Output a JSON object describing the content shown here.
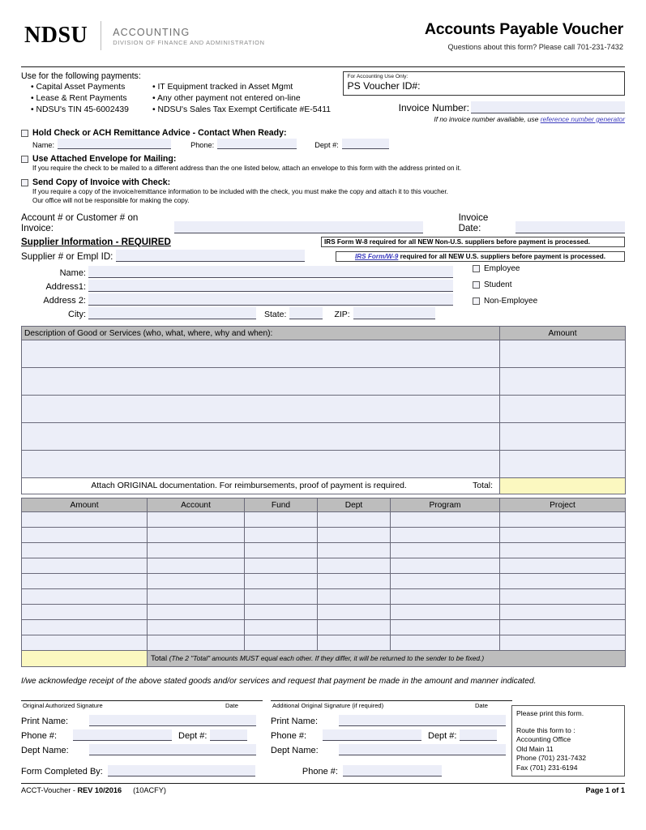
{
  "header": {
    "logo": "NDSU",
    "dept_main": "ACCOUNTING",
    "dept_sub": "DIVISION OF FINANCE AND ADMINISTRATION",
    "title": "Accounts Payable Voucher",
    "subtitle": "Questions about this form? Please call 701-231-7432"
  },
  "uses": {
    "title": "Use for the following payments:",
    "items_left": [
      "Capital Asset Payments",
      "Lease & Rent Payments",
      "NDSU's TIN 45-6002439"
    ],
    "items_right": [
      "IT Equipment tracked in Asset Mgmt",
      "Any other payment not entered on-line",
      "NDSU's Sales Tax Exempt Certificate #E-5411"
    ]
  },
  "accounting_use": {
    "small_label": "For Accounting Use Only:",
    "voucher_label": "PS Voucher ID#:",
    "voucher_value": "",
    "invoice_number_label": "Invoice Number:",
    "invoice_number_value": "",
    "invoice_note_prefix": "If no invoice number available, use ",
    "invoice_note_link": "reference number generator"
  },
  "options": [
    {
      "title": "Hold Check or ACH Remittance Advice - Contact When Ready:",
      "checked": false,
      "fields": [
        {
          "label": "Name:",
          "value": ""
        },
        {
          "label": "Phone:",
          "value": ""
        },
        {
          "label": "Dept #:",
          "value": ""
        }
      ],
      "desc": []
    },
    {
      "title": "Use Attached Envelope for Mailing:",
      "checked": false,
      "fields": [],
      "desc": [
        "If you require the check to be mailed to a different address than the one listed below, attach an envelope to this form with the address printed on it."
      ]
    },
    {
      "title": "Send Copy of Invoice with Check:",
      "checked": false,
      "fields": [],
      "desc": [
        "If you require a copy of the invoice/remittance information to be included with the check, you must make the copy and attach it to this voucher.",
        "Our office will not be responsible for making the copy."
      ]
    }
  ],
  "account_line": {
    "label": "Account # or Customer # on Invoice:",
    "value": "",
    "invoice_date_label": "Invoice Date:",
    "invoice_date_value": ""
  },
  "supplier": {
    "section_title": "Supplier Information - REQUIRED",
    "id_label": "Supplier # or Empl ID:",
    "id_value": "",
    "w8_notice": "IRS Form W-8 required for all NEW Non-U.S. suppliers before payment is processed.",
    "w9_link": "IRS Form/W-9",
    "w9_notice": " required for all NEW U.S. suppliers before payment is processed.",
    "fields": [
      {
        "label": "Name:",
        "value": ""
      },
      {
        "label": "Address1:",
        "value": ""
      },
      {
        "label": "Address 2:",
        "value": ""
      }
    ],
    "city_label": "City:",
    "city_value": "",
    "state_label": "State:",
    "state_value": "",
    "zip_label": "ZIP:",
    "zip_value": "",
    "types": [
      {
        "label": "Employee",
        "checked": false
      },
      {
        "label": "Student",
        "checked": false
      },
      {
        "label": "Non-Employee",
        "checked": false
      }
    ]
  },
  "description_table": {
    "header_description": "Description of Good or Services (who, what, where, why and when):",
    "header_amount": "Amount",
    "rows": [
      {
        "description": "",
        "amount": ""
      },
      {
        "description": "",
        "amount": ""
      },
      {
        "description": "",
        "amount": ""
      },
      {
        "description": "",
        "amount": ""
      },
      {
        "description": "",
        "amount": ""
      }
    ],
    "footer_note": "Attach ORIGINAL documentation. For reimbursements, proof of payment is required.",
    "total_label": "Total:",
    "total_value": ""
  },
  "accounting_table": {
    "headers": [
      "Amount",
      "Account",
      "Fund",
      "Dept",
      "Program",
      "Project"
    ],
    "rows": [
      [
        "",
        "",
        "",
        "",
        "",
        ""
      ],
      [
        "",
        "",
        "",
        "",
        "",
        ""
      ],
      [
        "",
        "",
        "",
        "",
        "",
        ""
      ],
      [
        "",
        "",
        "",
        "",
        "",
        ""
      ],
      [
        "",
        "",
        "",
        "",
        "",
        ""
      ],
      [
        "",
        "",
        "",
        "",
        "",
        ""
      ],
      [
        "",
        "",
        "",
        "",
        "",
        ""
      ],
      [
        "",
        "",
        "",
        "",
        "",
        ""
      ],
      [
        "",
        "",
        "",
        "",
        "",
        ""
      ]
    ],
    "total_value": "",
    "total_label": "Total",
    "total_note": "(The 2 \"Total\" amounts MUST equal each other. If they differ, it will be returned to the sender to be fixed.)"
  },
  "acknowledgement": "I/we acknowledge receipt of the above stated goods and/or services and request that payment be made in the amount and manner indicated.",
  "signatures": {
    "left": {
      "caption": "Original Authorized Signature",
      "date_caption": "Date",
      "print_name_label": "Print Name:",
      "print_name_value": "",
      "phone_label": "Phone #:",
      "phone_value": "",
      "dept_num_label": "Dept #:",
      "dept_num_value": "",
      "dept_name_label": "Dept Name:",
      "dept_name_value": ""
    },
    "right": {
      "caption": "Additional Original Signature (if required)",
      "date_caption": "Date",
      "print_name_label": "Print Name:",
      "print_name_value": "",
      "phone_label": "Phone #:",
      "phone_value": "",
      "dept_num_label": "Dept #:",
      "dept_num_value": "",
      "dept_name_label": "Dept Name:",
      "dept_name_value": ""
    }
  },
  "route_box": {
    "line1": "Please print this form.",
    "line2": "Route this form to :",
    "line3": "Accounting Office",
    "line4": "Old Main 11",
    "line5": "Phone (701) 231-7432",
    "line6": "Fax (701) 231-6194"
  },
  "completed_by": {
    "label": "Form Completed By:",
    "value": "",
    "phone_label": "Phone #:",
    "phone_value": ""
  },
  "footer": {
    "left_plain": "ACCT-Voucher - ",
    "left_bold": "REV 10/2016",
    "left_code": "(10ACFY)",
    "right": "Page 1 of 1"
  },
  "colors": {
    "field_fill": "#eceef8",
    "header_gray": "#bdbdbd",
    "total_yellow": "#fbf8c0",
    "link_blue": "#3b3bbd"
  }
}
